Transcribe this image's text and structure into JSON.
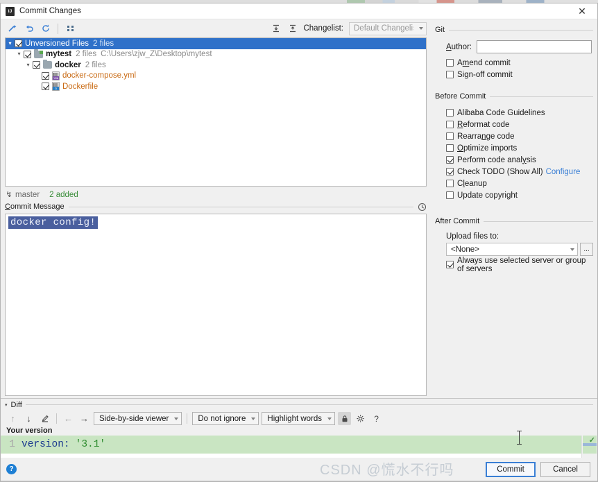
{
  "window": {
    "title": "Commit Changes",
    "app_icon": "intellij-idea-icon",
    "close_icon": "close-icon"
  },
  "toolbar": {
    "buttons": [
      {
        "name": "show-diff-icon",
        "glyph": "✦"
      },
      {
        "name": "revert-icon",
        "glyph": "↶"
      },
      {
        "name": "refresh-icon",
        "glyph": "⟳"
      },
      {
        "name": "group-by-icon",
        "glyph": "∷"
      }
    ],
    "right_buttons": [
      {
        "name": "expand-all-icon",
        "glyph": "⤓"
      },
      {
        "name": "collapse-all-icon",
        "glyph": "⤒"
      }
    ],
    "changelist_label": "Changelist:",
    "changelist_mnemonic": "g",
    "changelist_value": "Default Changelist"
  },
  "file_tree": {
    "root": {
      "label": "Unversioned Files",
      "count": "2 files",
      "checked": true,
      "selected": true,
      "expanded": true
    },
    "nodes": [
      {
        "label": "mytest",
        "count": "2 files",
        "path": "C:\\Users\\zjw_Z\\Desktop\\mytest",
        "checked": true,
        "expanded": true,
        "icon": "module-folder-icon",
        "level": 1
      },
      {
        "label": "docker",
        "count": "2 files",
        "path": "",
        "checked": true,
        "expanded": true,
        "icon": "folder-icon",
        "level": 2
      },
      {
        "label": "docker-compose.yml",
        "count": "",
        "path": "",
        "checked": true,
        "expanded": null,
        "icon": "yaml-file-icon",
        "badge": "YML",
        "level": 3
      },
      {
        "label": "Dockerfile",
        "count": "",
        "path": "",
        "checked": true,
        "expanded": null,
        "icon": "dockerfile-icon",
        "badge": "D",
        "level": 3
      }
    ]
  },
  "branch_bar": {
    "icon": "branch-icon",
    "branch": "master",
    "status": "2 added"
  },
  "commit_message": {
    "title": "Commit Message",
    "mnemonic": "C",
    "history_icon": "clock-icon",
    "value": "docker config!",
    "selected": true
  },
  "git_panel": {
    "title": "Git",
    "author_label": "Author:",
    "author_mnemonic": "A",
    "author_value": "",
    "checkboxes": [
      {
        "label": "Amend commit",
        "mnemonic": "A",
        "checked": false,
        "name": "amend-commit"
      },
      {
        "label": "Sign-off commit",
        "mnemonic": "g",
        "checked": false,
        "name": "sign-off-commit"
      }
    ]
  },
  "before_commit": {
    "title": "Before Commit",
    "checkboxes": [
      {
        "label": "Alibaba Code Guidelines",
        "mnemonic": "",
        "checked": false,
        "name": "alibaba-code-guidelines"
      },
      {
        "label": "Reformat code",
        "mnemonic": "R",
        "checked": false,
        "name": "reformat-code"
      },
      {
        "label": "Rearrange code",
        "mnemonic": "n",
        "checked": false,
        "name": "rearrange-code"
      },
      {
        "label": "Optimize imports",
        "mnemonic": "O",
        "checked": false,
        "name": "optimize-imports"
      },
      {
        "label": "Perform code analysis",
        "mnemonic": "y",
        "checked": true,
        "name": "perform-code-analysis"
      },
      {
        "label": "Check TODO (Show All)",
        "mnemonic": "",
        "checked": true,
        "name": "check-todo",
        "link": "Configure"
      },
      {
        "label": "Cleanup",
        "mnemonic": "l",
        "checked": false,
        "name": "cleanup"
      },
      {
        "label": "Update copyright",
        "mnemonic": "",
        "checked": false,
        "name": "update-copyright"
      }
    ]
  },
  "after_commit": {
    "title": "After Commit",
    "upload_label": "Upload files to:",
    "upload_value": "<None>",
    "browse_label": "...",
    "always_use": {
      "label": "Always use selected server or group of servers",
      "checked": true
    }
  },
  "diff": {
    "title": "Diff",
    "expanded": true,
    "nav_buttons": [
      {
        "name": "previous-difference-icon",
        "glyph": "↑",
        "disabled": true
      },
      {
        "name": "next-difference-icon",
        "glyph": "↓",
        "disabled": false
      },
      {
        "name": "edit-source-icon",
        "glyph": "✐",
        "disabled": false
      },
      {
        "name": "accept-left-icon",
        "glyph": "←",
        "disabled": true
      },
      {
        "name": "accept-right-icon",
        "glyph": "→",
        "disabled": false
      }
    ],
    "viewer_mode": "Side-by-side viewer",
    "ignore_policy": "Do not ignore",
    "highlight_policy": "Highlight words",
    "lock_icon": "lock-icon",
    "settings_icon": "gear-icon",
    "help_icon": "question-mark-icon",
    "pane_label": "Your version",
    "line_number": "1",
    "code_keyword": "version:",
    "code_string": "'3.1'",
    "scroll_marker_icon": "check-icon"
  },
  "footer": {
    "help_icon": "question-mark-icon",
    "commit_label": "Commit",
    "cancel_label": "Cancel",
    "watermark_prefix": "CSDN @",
    "watermark_text": "慌水不行吗"
  },
  "colors": {
    "selection_blue": "#2f71c9",
    "unversioned_orange": "#c96a13",
    "added_green": "#3d8f3d",
    "diff_added_bg": "#c9e5c2",
    "link_blue": "#3a7fd5",
    "msg_selection": "#4a5f9e"
  }
}
